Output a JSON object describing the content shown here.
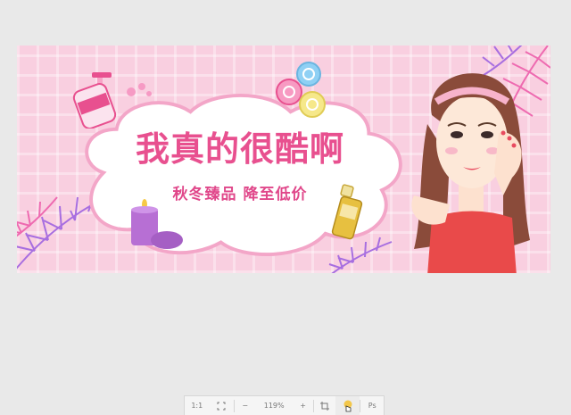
{
  "banner": {
    "headline": "我真的很酷啊",
    "subline": "秋冬臻品  降至低价"
  },
  "toolbar": {
    "actual_size_label": "1:1",
    "zoom_level": "119%",
    "minus_label": "−",
    "plus_label": "+",
    "ps_label": "Ps"
  },
  "colors": {
    "background": "#e9e9e9",
    "banner_pink": "#f9cfe0",
    "headline_pink": "#e8508f",
    "leaf_purple": "#a76ee0",
    "leaf_pink": "#ee6ab0"
  }
}
